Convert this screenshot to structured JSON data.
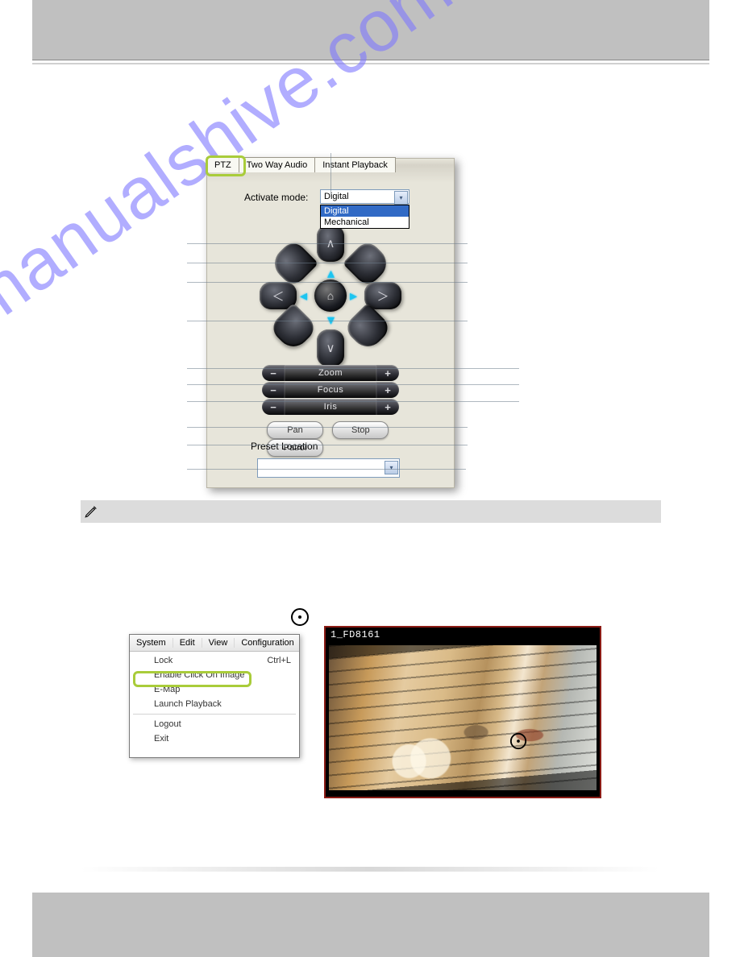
{
  "watermark_text": "manualshive.com",
  "ptz": {
    "tabs": [
      "PTZ",
      "Two Way Audio",
      "Instant Playback"
    ],
    "activate_label": "Activate mode:",
    "activate_value": "Digital",
    "activate_options": [
      "Digital",
      "Mechanical"
    ],
    "controls": {
      "zoom_label": "Zoom",
      "focus_label": "Focus",
      "iris_label": "Iris",
      "minus": "−",
      "plus": "+"
    },
    "action_buttons": [
      "Pan",
      "Stop",
      "Patrol"
    ],
    "preset_label": "Preset Location",
    "preset_value": ""
  },
  "system_menu": {
    "menubar": [
      "System",
      "Edit",
      "View",
      "Configuration"
    ],
    "items": [
      {
        "label": "Lock",
        "shortcut": "Ctrl+L"
      },
      {
        "label": "Enable Click On Image",
        "shortcut": ""
      },
      {
        "label": "E-Map",
        "shortcut": ""
      },
      {
        "label": "Launch Playback",
        "shortcut": ""
      },
      {
        "label": "Logout",
        "shortcut": ""
      },
      {
        "label": "Exit",
        "shortcut": ""
      }
    ]
  },
  "camera": {
    "title": "1_FD8161"
  }
}
